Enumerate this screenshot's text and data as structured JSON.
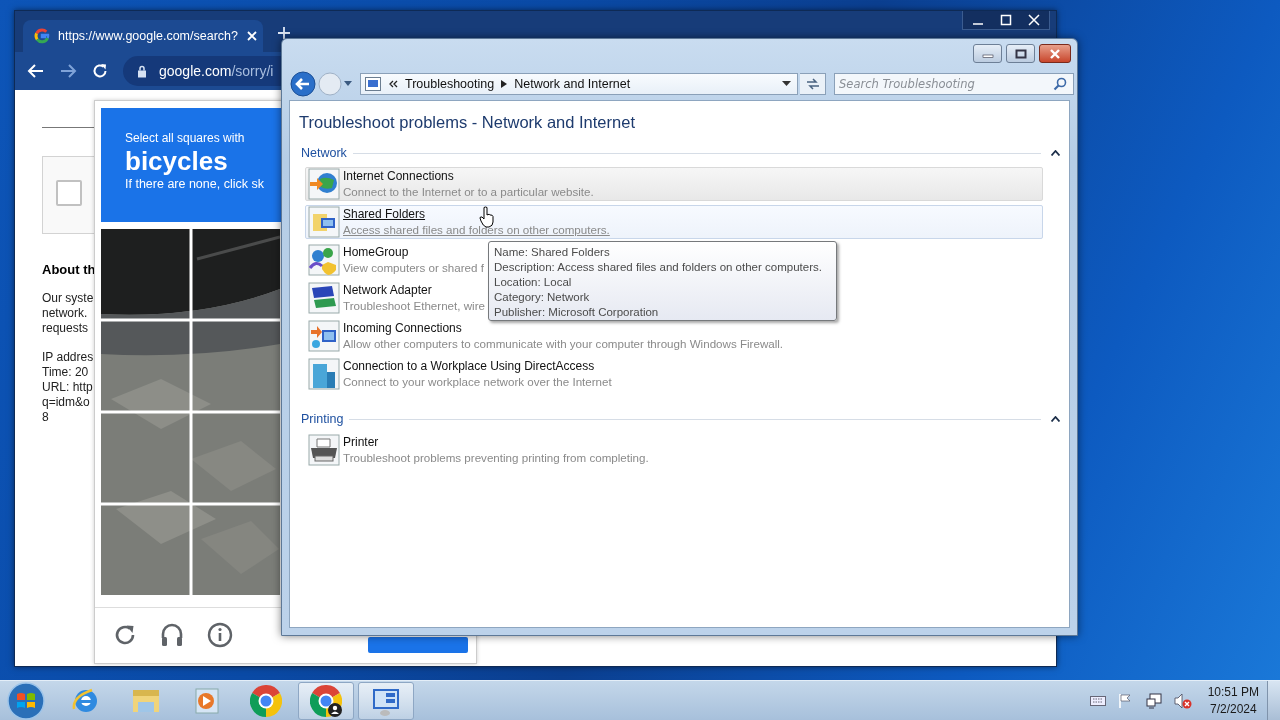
{
  "browser": {
    "tab_title": "https://www.google.com/search?",
    "url_host": "google.com",
    "url_path": "/sorry/i",
    "page": {
      "checked": false,
      "heading": "About th",
      "paragraphs": [
        [
          "Our syste",
          "network.",
          "requests"
        ],
        [
          "IP addres",
          "Time: 20",
          "URL: http",
          "q=idm&o",
          "8"
        ]
      ]
    },
    "captcha": {
      "prompt": "Select all squares with",
      "target": "bicycles",
      "hint": "If there are none, click sk"
    }
  },
  "window": {
    "crumbs": [
      "Troubleshooting",
      "Network and Internet"
    ],
    "search": {
      "placeholder": "Search Troubleshooting"
    },
    "heading": "Troubleshoot problems - Network and Internet",
    "groups": [
      {
        "title": "Network",
        "expanded": true,
        "items": [
          {
            "title": "Internet Connections",
            "description": "Connect to the Internet or to a particular website.",
            "selected": true,
            "hovered": false
          },
          {
            "title": "Shared Folders",
            "description": "Access shared files and folders on other computers.",
            "selected": false,
            "hovered": true
          },
          {
            "title": "HomeGroup",
            "description": "View computers or shared f",
            "selected": false,
            "hovered": false
          },
          {
            "title": "Network Adapter",
            "description": "Troubleshoot Ethernet, wire",
            "selected": false,
            "hovered": false
          },
          {
            "title": "Incoming Connections",
            "description": "Allow other computers to communicate with your computer through Windows Firewall.",
            "selected": false,
            "hovered": false
          },
          {
            "title": "Connection to a Workplace Using DirectAccess",
            "description": "Connect to your workplace network over the Internet",
            "selected": false,
            "hovered": false
          }
        ]
      },
      {
        "title": "Printing",
        "expanded": true,
        "items": [
          {
            "title": "Printer",
            "description": "Troubleshoot problems preventing printing from completing.",
            "selected": false,
            "hovered": false
          }
        ]
      }
    ],
    "tooltip": [
      "Name: Shared Folders",
      "Description: Access shared files and folders on other computers.",
      "Location: Local",
      "Category: Network",
      "Publisher: Microsoft Corporation"
    ]
  },
  "taskbar": {
    "apps": [
      {
        "open": false
      },
      {
        "open": false
      },
      {
        "open": false
      },
      {
        "open": false
      },
      {
        "open": true
      },
      {
        "open": true
      }
    ],
    "clock": {
      "time": "10:51 PM",
      "date": "7/2/2024"
    }
  }
}
